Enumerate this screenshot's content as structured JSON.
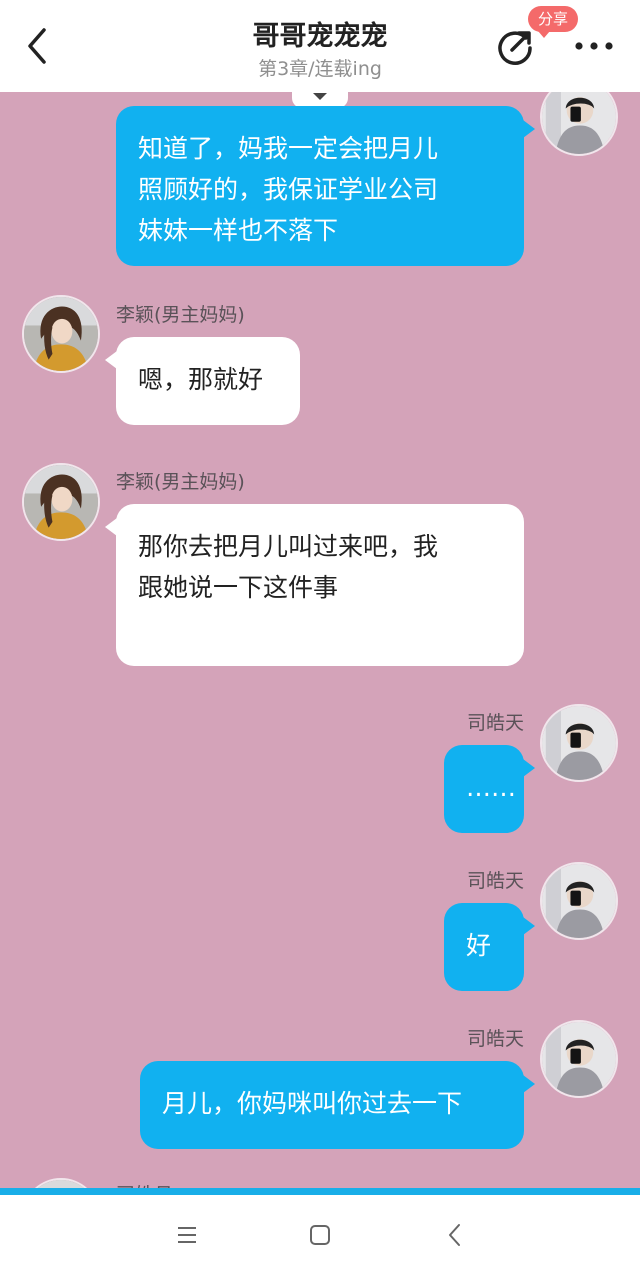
{
  "header": {
    "title": "哥哥宠宠宠",
    "subtitle": "第3章/连载ing",
    "share_badge": "分享",
    "back_icon": "back-arrow-icon",
    "share_icon": "share-icon",
    "more_icon": "more-icon"
  },
  "messages": [
    {
      "side": "right",
      "speaker": "",
      "text": "知道了，妈我一定会把月儿\n照顾好的，我保证学业公司\n妹妹一样也不落下",
      "avatar": "boy"
    },
    {
      "side": "left",
      "speaker": "李颖(男主妈妈)",
      "text": "嗯，那就好",
      "avatar": "girl"
    },
    {
      "side": "left",
      "speaker": "李颖(男主妈妈)",
      "text": "那你去把月儿叫过来吧，我\n跟她说一下这件事\n",
      "avatar": "girl"
    },
    {
      "side": "right",
      "speaker": "司皓天",
      "text": "……",
      "avatar": "boy"
    },
    {
      "side": "right",
      "speaker": "司皓天",
      "text": "好",
      "avatar": "boy"
    },
    {
      "side": "right",
      "speaker": "司皓天",
      "text": "月儿，你妈咪叫你过去一下",
      "avatar": "boy"
    }
  ],
  "partial_message": {
    "speaker": "司皓月"
  },
  "colors": {
    "background": "#d4a3b9",
    "blue_bubble": "#11b1f0",
    "white_bubble": "#ffffff",
    "badge": "#f46a6a"
  },
  "nav": {
    "menu_icon": "menu-icon",
    "home_icon": "home-icon",
    "back_icon": "back-icon"
  }
}
